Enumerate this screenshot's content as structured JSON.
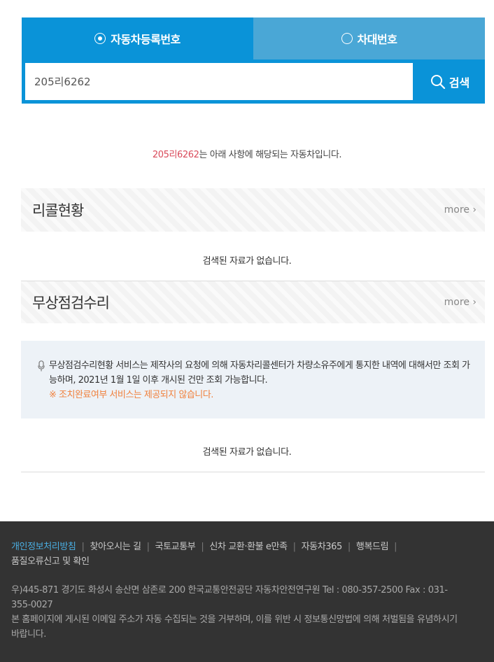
{
  "tabs": [
    {
      "label": "자동차등록번호",
      "selected": true
    },
    {
      "label": "차대번호",
      "selected": false
    }
  ],
  "search": {
    "value": "205리6262",
    "button_label": "검색"
  },
  "result": {
    "plate": "205리6262",
    "suffix": "는 아래 사항에 해당되는 자동차입니다."
  },
  "sections": [
    {
      "title": "리콜현황",
      "more": "more",
      "empty": "검색된 자료가 없습니다."
    },
    {
      "title": "무상점검수리",
      "more": "more",
      "empty": "검색된 자료가 없습니다."
    }
  ],
  "notice": {
    "text": "무상점검수리현황 서비스는 제작사의 요청에 의해 자동차리콜센터가 차량소유주에게 통지한 내역에 대해서만 조회 가능하며, 2021년 1월 1일 이후 개시된 건만 조회 가능합니다.",
    "warning": "※ 조치완료여부 서비스는 제공되지 않습니다."
  },
  "footer": {
    "links": [
      "개인정보처리방침",
      "찾아오시는 길",
      "국토교통부",
      "신차 교환·환불 e만족",
      "자동차365",
      "행복드림",
      "품질오류신고 및 확인"
    ],
    "address": "우)445-871 경기도 화성시 송산면 삼존로 200 한국교통안전공단 자동차안전연구원 Tel : 080-357-2500 Fax : 031-355-0027",
    "disclaimer": "본 홈페이지에 게시된 이메일 주소가 자동 수집되는 것을 거부하며, 이를 위반 시 정보통신망법에 의해 처벌됨을 유념하시기 바랍니다."
  },
  "colors": {
    "accent": "#0a93d8",
    "tab_inactive": "#4aa7d6",
    "plate_highlight": "#d94a5a",
    "warning": "#f0803c",
    "footer_bg": "#333333"
  }
}
